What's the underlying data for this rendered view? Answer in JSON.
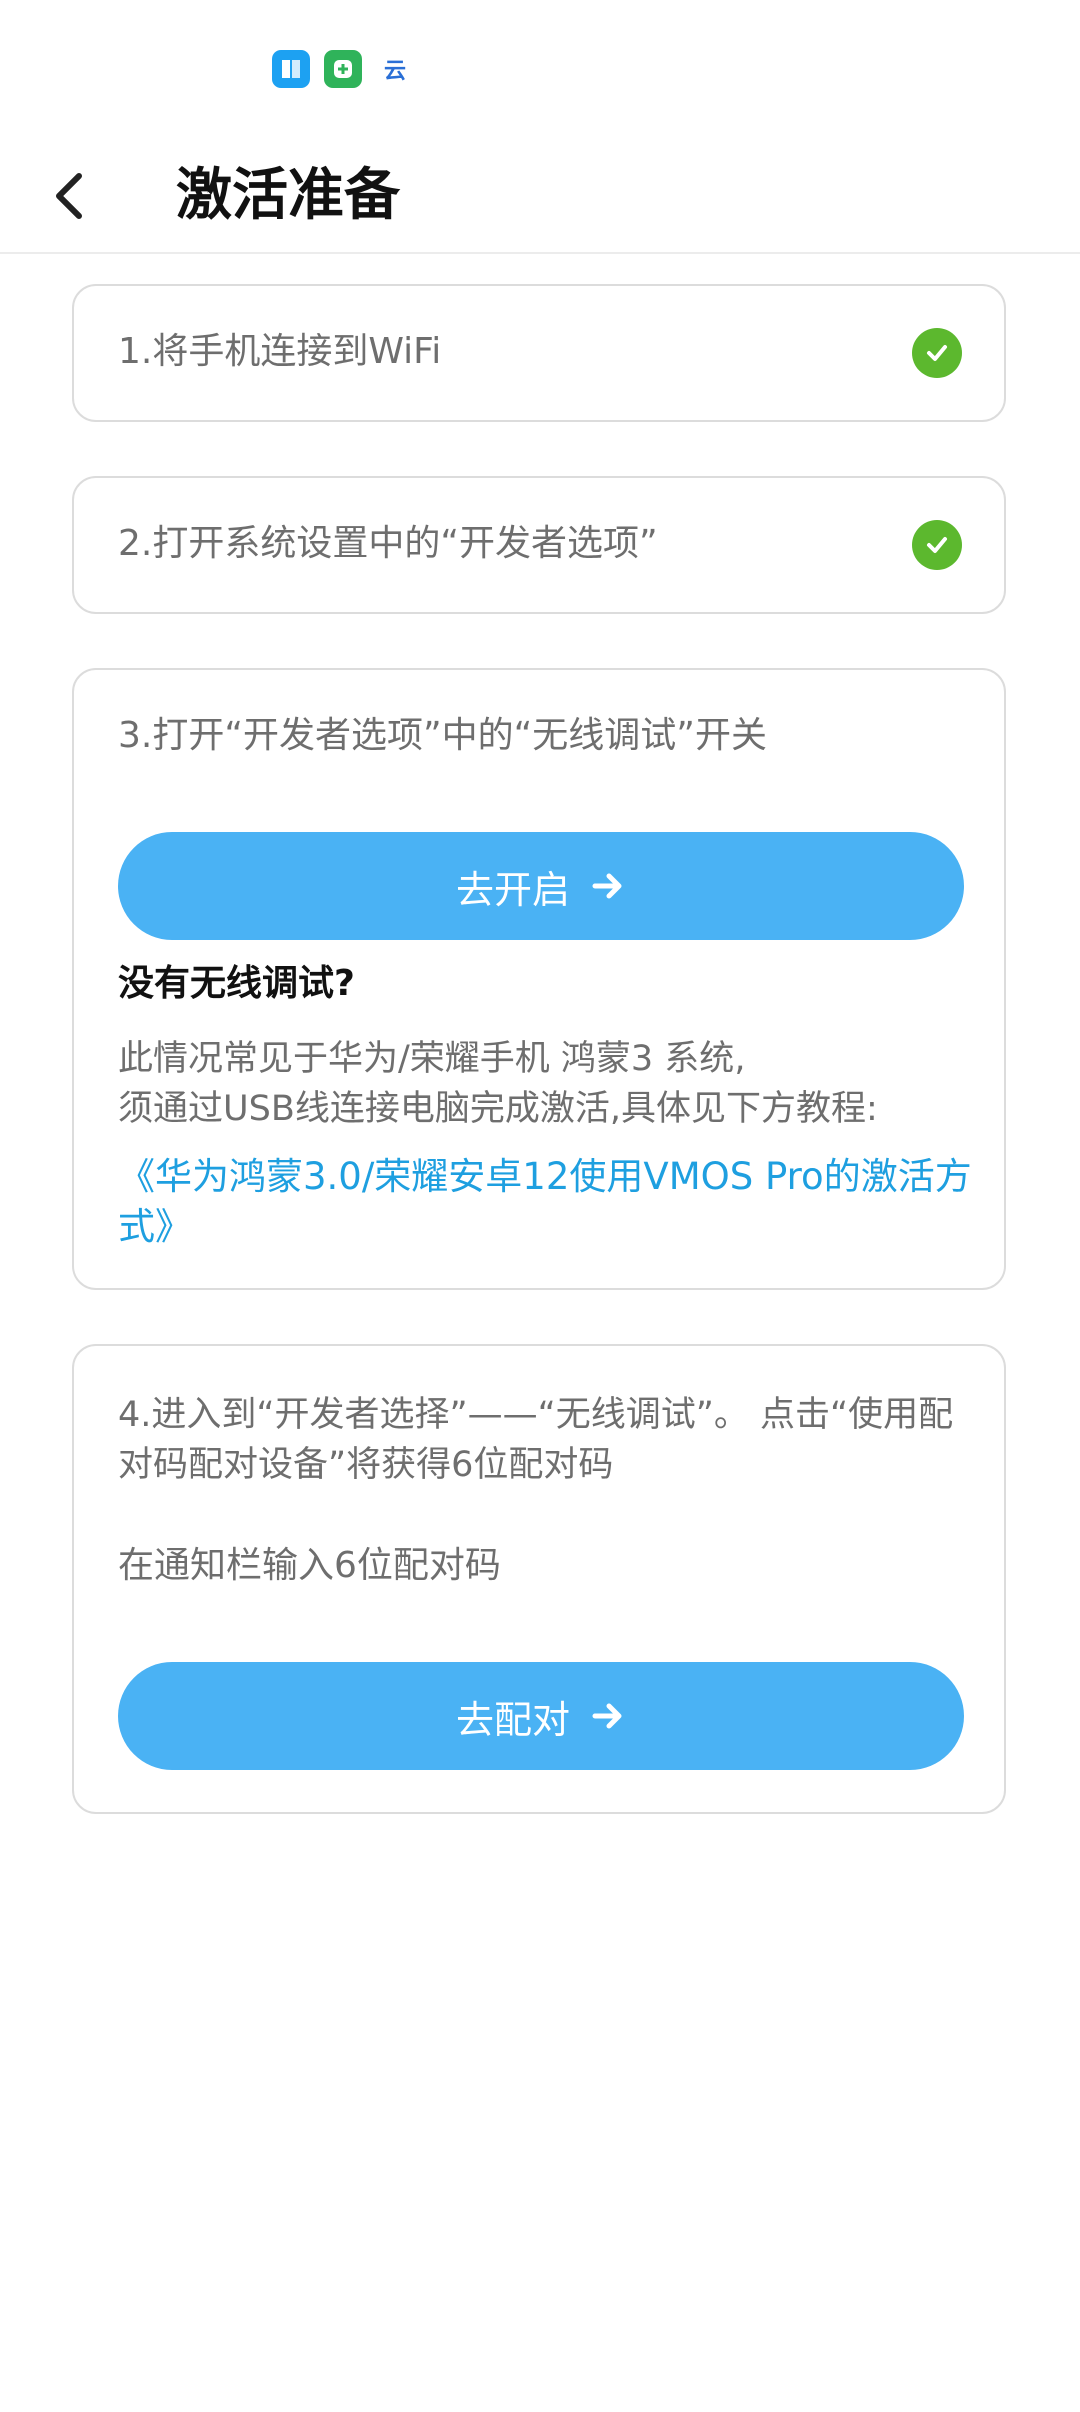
{
  "status_bar": {
    "icons": [
      {
        "name": "store-icon",
        "glyph": "▦",
        "color": "#1da1f2"
      },
      {
        "name": "shield-plus-icon",
        "glyph": "✚",
        "color": "#2fb35a"
      },
      {
        "name": "cloud-app-icon",
        "glyph": "云",
        "color": "#2a6fd6"
      }
    ]
  },
  "header": {
    "title": "激活准备"
  },
  "steps": [
    {
      "text": "1.将手机连接到WiFi",
      "done": true
    },
    {
      "text": "2.打开系统设置中的“开发者选项”",
      "done": true
    },
    {
      "text": "3.打开“开发者选项”中的“无线调试”开关",
      "button_label": "去开启",
      "help_title": "没有无线调试?",
      "help_desc_line1": "此情况常见于华为/荣耀手机 鸿蒙3 系统,",
      "help_desc_line2": "须通过USB线连接电脑完成激活,具体见下方教程:",
      "tutorial_link": "《华为鸿蒙3.0/荣耀安卓12使用VMOS Pro的激活方式》"
    },
    {
      "text": "4.进入到“开发者选择”——“无线调试”。 点击“使用配对码配对设备”将获得6位配对码",
      "text2": "在通知栏输入6位配对码",
      "button_label": "去配对"
    }
  ],
  "colors": {
    "accent": "#4ab2f4",
    "check": "#5cb82e",
    "link": "#1e9fe0"
  }
}
